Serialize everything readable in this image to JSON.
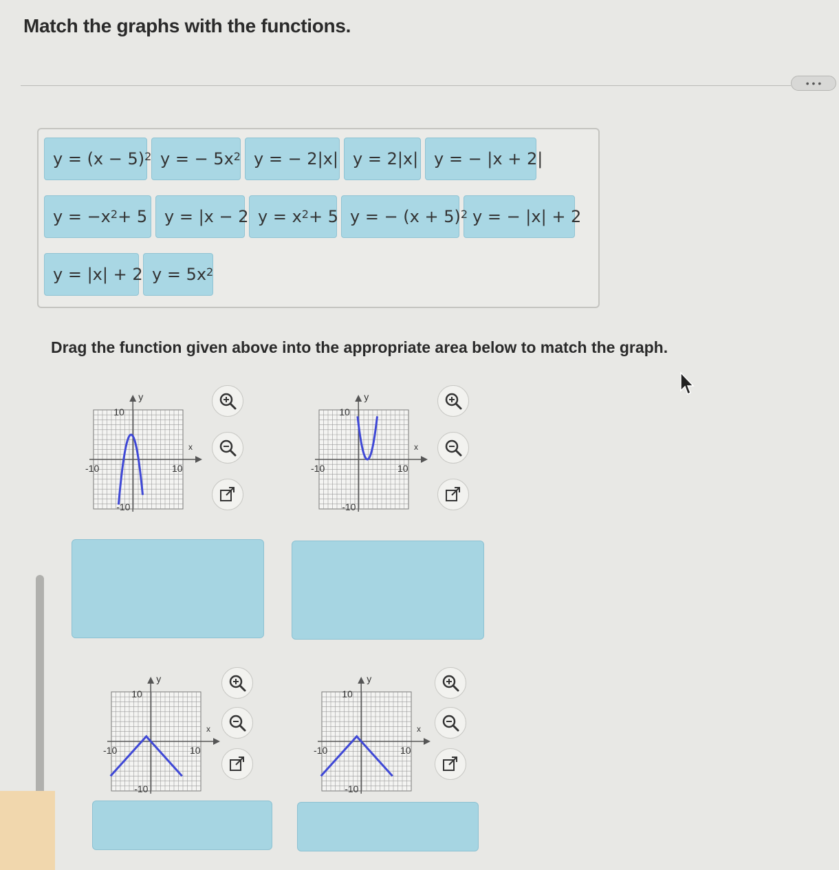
{
  "title": "Match the graphs with the functions.",
  "more_button": "• • •",
  "function_bank": {
    "row1": [
      {
        "base": "y = (x − 5)",
        "sup": "2"
      },
      {
        "base": "y = − 5x",
        "sup": "2"
      },
      {
        "base": "y = − 2|x|",
        "sup": ""
      },
      {
        "base": "y = 2|x|",
        "sup": ""
      },
      {
        "base": "y = − |x + 2|",
        "sup": ""
      }
    ],
    "row2": [
      {
        "base": "y = −x",
        "sup": "2",
        "tail": " + 5"
      },
      {
        "base": "y = |x − 2|",
        "sup": "",
        "tail": ""
      },
      {
        "base": "y = x",
        "sup": "2",
        "tail": " + 5"
      },
      {
        "base": "y = − (x + 5)",
        "sup": "2",
        "tail": ""
      },
      {
        "base": "y = − |x| + 2",
        "sup": "",
        "tail": ""
      }
    ],
    "row3": [
      {
        "base": "y = |x| + 2",
        "sup": ""
      },
      {
        "base": "y = 5x",
        "sup": "2"
      }
    ]
  },
  "instructions": "Drag the function given above into the appropriate area below to match the graph.",
  "graph_labels": {
    "y_axis": "y",
    "x_axis": "x",
    "y_max": "10",
    "y_min": "-10",
    "x_max": "10",
    "x_min": "-10"
  },
  "graphs": [
    {
      "curve": "down-parabola",
      "color": "#3f48d6"
    },
    {
      "curve": "up-parabola",
      "color": "#3f48d6"
    },
    {
      "curve": "down-v",
      "color": "#3f48d6"
    },
    {
      "curve": "down-v",
      "color": "#3f48d6"
    }
  ],
  "tools": [
    "zoom-in",
    "zoom-out",
    "open-new-window"
  ],
  "colors": {
    "tile": "#a9d7e4",
    "dropzone": "#a6d5e2",
    "curve": "#3f48d6",
    "background": "#e8e8e5"
  }
}
